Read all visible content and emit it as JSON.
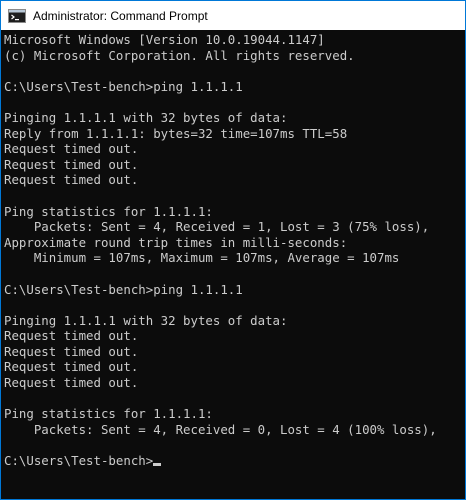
{
  "window": {
    "title": "Administrator: Command Prompt",
    "icon": "cmd-icon"
  },
  "console": {
    "lines": [
      "Microsoft Windows [Version 10.0.19044.1147]",
      "(c) Microsoft Corporation. All rights reserved.",
      "",
      "C:\\Users\\Test-bench>ping 1.1.1.1",
      "",
      "Pinging 1.1.1.1 with 32 bytes of data:",
      "Reply from 1.1.1.1: bytes=32 time=107ms TTL=58",
      "Request timed out.",
      "Request timed out.",
      "Request timed out.",
      "",
      "Ping statistics for 1.1.1.1:",
      "    Packets: Sent = 4, Received = 1, Lost = 3 (75% loss),",
      "Approximate round trip times in milli-seconds:",
      "    Minimum = 107ms, Maximum = 107ms, Average = 107ms",
      "",
      "C:\\Users\\Test-bench>ping 1.1.1.1",
      "",
      "Pinging 1.1.1.1 with 32 bytes of data:",
      "Request timed out.",
      "Request timed out.",
      "Request timed out.",
      "Request timed out.",
      "",
      "Ping statistics for 1.1.1.1:",
      "    Packets: Sent = 4, Received = 0, Lost = 4 (100% loss),",
      "",
      "C:\\Users\\Test-bench>"
    ]
  },
  "colors": {
    "background": "#0c0c0c",
    "text": "#cccccc",
    "titlebar": "#ffffff",
    "border": "#0078d7"
  }
}
